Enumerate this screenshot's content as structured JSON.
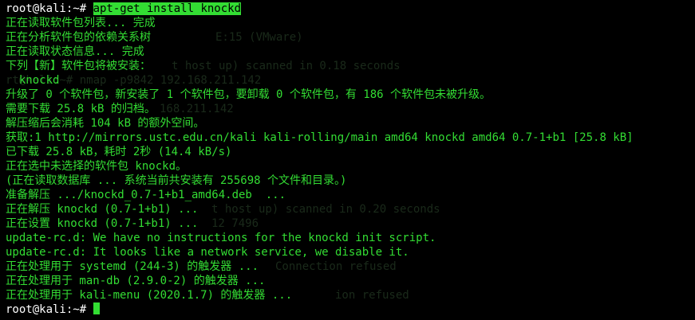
{
  "terminal": {
    "prompt": "root@kali:~# ",
    "command": "apt-get install knockd",
    "output": [
      "正在读取软件包列表... 完成",
      "正在分析软件包的依赖关系树",
      "正在读取状态信息... 完成",
      "下列【新】软件包将被安装：",
      "  knockd",
      "升级了 0 个软件包，新安装了 1 个软件包，要卸载 0 个软件包，有 186 个软件包未被升级。",
      "需要下载 25.8 kB 的归档。",
      "解压缩后会消耗 104 kB 的额外空间。",
      "获取:1 http://mirrors.ustc.edu.cn/kali kali-rolling/main amd64 knockd amd64 0.7-1+b1 [25.8 kB]",
      "已下载 25.8 kB，耗时 2秒 (14.4 kB/s)",
      "正在选中未选择的软件包 knockd。",
      "(正在读取数据库 ... 系统当前共安装有 255698 个文件和目录。)",
      "准备解压 .../knockd_0.7-1+b1_amd64.deb  ...",
      "正在解压 knockd (0.7-1+b1) ...",
      "正在设置 knockd (0.7-1+b1) ...",
      "update-rc.d: We have no instructions for the knockd init script.",
      "update-rc.d: It looks like a network service, we disable it.",
      "正在处理用于 systemd (244-3) 的触发器 ...",
      "正在处理用于 man-db (2.9.0-2) 的触发器 ...",
      "正在处理用于 kali-menu (2020.1.7) 的触发器 ..."
    ],
    "final_prompt": "root@kali:~# ",
    "ghost_lines": [
      "E:15 (VMware)",
      "t host up) scanned in 0.18 seconds",
      "rt@kali:~# nmap -p9842 192.168.211.142",
      "168.211.142",
      "t host up) scanned in 0.20 seconds",
      "12 7496",
      "Connection refused",
      "ion refused"
    ]
  },
  "colors": {
    "background": "#000000",
    "text": "#33dd33",
    "prompt": "#ffffff",
    "highlight": "#33dd33"
  }
}
